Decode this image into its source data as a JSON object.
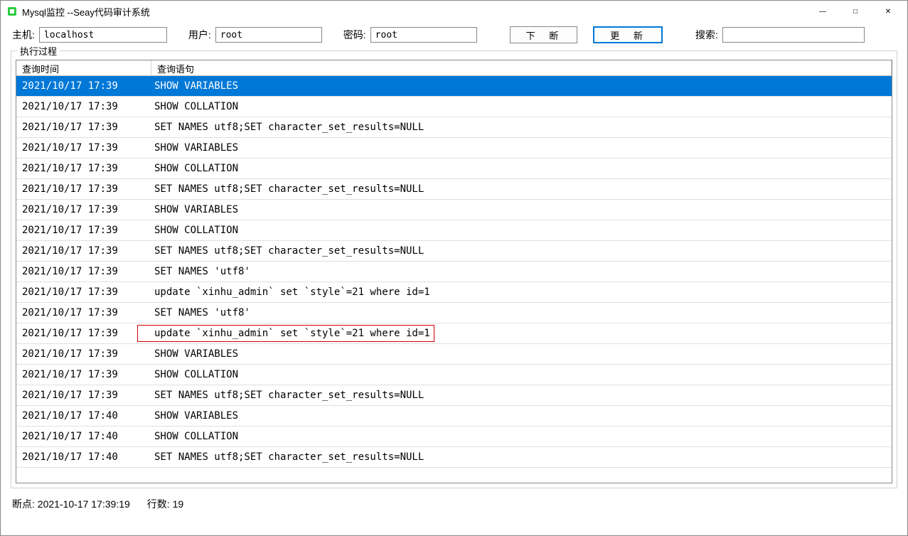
{
  "window": {
    "title": "Mysql监控 --Seay代码审计系统"
  },
  "toolbar": {
    "host_label": "主机:",
    "host_value": "localhost",
    "user_label": "用户:",
    "user_value": "root",
    "pass_label": "密码:",
    "pass_value": "root",
    "break_btn": "下 断",
    "refresh_btn": "更 新",
    "search_label": "搜索:",
    "search_value": ""
  },
  "fieldset_title": "执行过程",
  "columns": {
    "time": "查询时间",
    "stmt": "查询语句"
  },
  "rows": [
    {
      "time": "2021/10/17 17:39",
      "stmt": "SHOW VARIABLES",
      "selected": true
    },
    {
      "time": "2021/10/17 17:39",
      "stmt": "SHOW COLLATION"
    },
    {
      "time": "2021/10/17 17:39",
      "stmt": "SET NAMES utf8;SET character_set_results=NULL"
    },
    {
      "time": "2021/10/17 17:39",
      "stmt": "SHOW VARIABLES"
    },
    {
      "time": "2021/10/17 17:39",
      "stmt": "SHOW COLLATION"
    },
    {
      "time": "2021/10/17 17:39",
      "stmt": "SET NAMES utf8;SET character_set_results=NULL"
    },
    {
      "time": "2021/10/17 17:39",
      "stmt": "SHOW VARIABLES"
    },
    {
      "time": "2021/10/17 17:39",
      "stmt": "SHOW COLLATION"
    },
    {
      "time": "2021/10/17 17:39",
      "stmt": "SET NAMES utf8;SET character_set_results=NULL"
    },
    {
      "time": "2021/10/17 17:39",
      "stmt": "SET NAMES 'utf8'"
    },
    {
      "time": "2021/10/17 17:39",
      "stmt": "update `xinhu_admin` set `style`=21 where id=1"
    },
    {
      "time": "2021/10/17 17:39",
      "stmt": "SET NAMES 'utf8'"
    },
    {
      "time": "2021/10/17 17:39",
      "stmt": "update `xinhu_admin` set `style`=21 where id=1",
      "highlight": true
    },
    {
      "time": "2021/10/17 17:39",
      "stmt": "SHOW VARIABLES"
    },
    {
      "time": "2021/10/17 17:39",
      "stmt": "SHOW COLLATION"
    },
    {
      "time": "2021/10/17 17:39",
      "stmt": "SET NAMES utf8;SET character_set_results=NULL"
    },
    {
      "time": "2021/10/17 17:40",
      "stmt": "SHOW VARIABLES"
    },
    {
      "time": "2021/10/17 17:40",
      "stmt": "SHOW COLLATION"
    },
    {
      "time": "2021/10/17 17:40",
      "stmt": "SET NAMES utf8;SET character_set_results=NULL"
    }
  ],
  "status": {
    "breakpoint_label": "断点:",
    "breakpoint_value": "2021-10-17 17:39:19",
    "count_label": "行数:",
    "count_value": "19"
  }
}
